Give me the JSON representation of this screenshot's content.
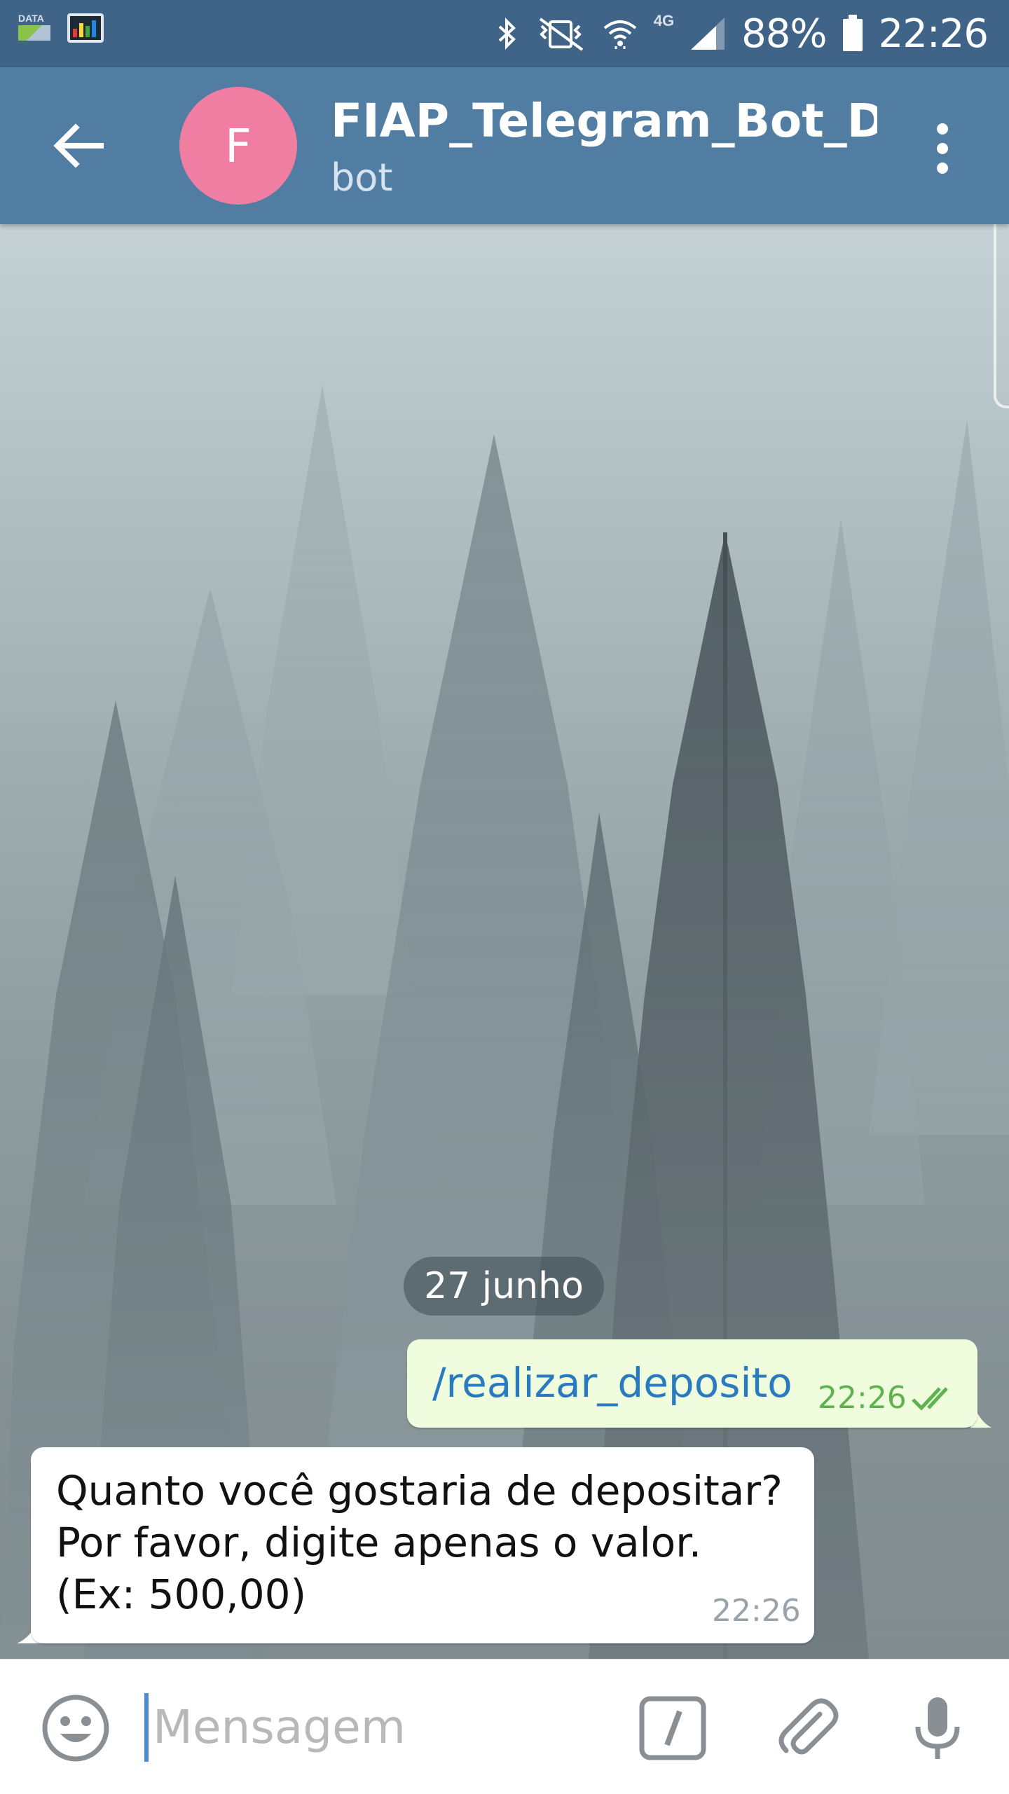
{
  "status_bar": {
    "data_label": "DATA",
    "network": "4G",
    "battery": "88%",
    "time": "22:26"
  },
  "header": {
    "avatar_letter": "F",
    "title": "FIAP_Telegram_Bot_D...",
    "subtitle": "bot"
  },
  "chat": {
    "date_separator": "27 junho",
    "messages": [
      {
        "direction": "outgoing",
        "text": "/realizar_deposito",
        "time": "22:26",
        "status": "read"
      },
      {
        "direction": "incoming",
        "lines": [
          "Quanto você gostaria de depositar?",
          "Por favor, digite apenas o valor.",
          "(Ex: 500,00)"
        ],
        "time": "22:26"
      }
    ]
  },
  "input_bar": {
    "placeholder": "Mensagem",
    "value": ""
  },
  "icons": {
    "back": "arrow-left-icon",
    "menu": "more-vert-icon",
    "emoji": "emoji-icon",
    "bot_commands": "slash-command-icon",
    "attach": "paperclip-icon",
    "mic": "microphone-icon"
  },
  "colors": {
    "header": "#527da3",
    "status_bar": "#3f6488",
    "avatar": "#f07ea2",
    "outgoing_bubble": "#effdde",
    "outgoing_text": "#2a7abf",
    "read_checks": "#5fb34e"
  }
}
